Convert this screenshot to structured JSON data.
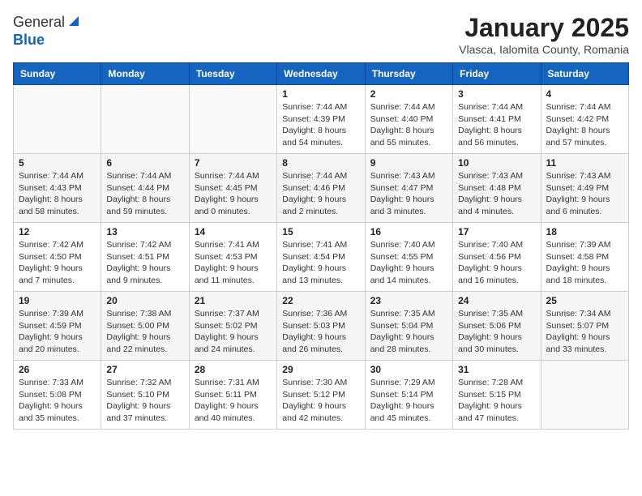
{
  "logo": {
    "general": "General",
    "blue": "Blue"
  },
  "title": "January 2025",
  "location": "Vlasca, Ialomita County, Romania",
  "weekdays": [
    "Sunday",
    "Monday",
    "Tuesday",
    "Wednesday",
    "Thursday",
    "Friday",
    "Saturday"
  ],
  "weeks": [
    [
      {
        "day": "",
        "info": ""
      },
      {
        "day": "",
        "info": ""
      },
      {
        "day": "",
        "info": ""
      },
      {
        "day": "1",
        "sunrise": "Sunrise: 7:44 AM",
        "sunset": "Sunset: 4:39 PM",
        "daylight": "Daylight: 8 hours and 54 minutes."
      },
      {
        "day": "2",
        "sunrise": "Sunrise: 7:44 AM",
        "sunset": "Sunset: 4:40 PM",
        "daylight": "Daylight: 8 hours and 55 minutes."
      },
      {
        "day": "3",
        "sunrise": "Sunrise: 7:44 AM",
        "sunset": "Sunset: 4:41 PM",
        "daylight": "Daylight: 8 hours and 56 minutes."
      },
      {
        "day": "4",
        "sunrise": "Sunrise: 7:44 AM",
        "sunset": "Sunset: 4:42 PM",
        "daylight": "Daylight: 8 hours and 57 minutes."
      }
    ],
    [
      {
        "day": "5",
        "sunrise": "Sunrise: 7:44 AM",
        "sunset": "Sunset: 4:43 PM",
        "daylight": "Daylight: 8 hours and 58 minutes."
      },
      {
        "day": "6",
        "sunrise": "Sunrise: 7:44 AM",
        "sunset": "Sunset: 4:44 PM",
        "daylight": "Daylight: 8 hours and 59 minutes."
      },
      {
        "day": "7",
        "sunrise": "Sunrise: 7:44 AM",
        "sunset": "Sunset: 4:45 PM",
        "daylight": "Daylight: 9 hours and 0 minutes."
      },
      {
        "day": "8",
        "sunrise": "Sunrise: 7:44 AM",
        "sunset": "Sunset: 4:46 PM",
        "daylight": "Daylight: 9 hours and 2 minutes."
      },
      {
        "day": "9",
        "sunrise": "Sunrise: 7:43 AM",
        "sunset": "Sunset: 4:47 PM",
        "daylight": "Daylight: 9 hours and 3 minutes."
      },
      {
        "day": "10",
        "sunrise": "Sunrise: 7:43 AM",
        "sunset": "Sunset: 4:48 PM",
        "daylight": "Daylight: 9 hours and 4 minutes."
      },
      {
        "day": "11",
        "sunrise": "Sunrise: 7:43 AM",
        "sunset": "Sunset: 4:49 PM",
        "daylight": "Daylight: 9 hours and 6 minutes."
      }
    ],
    [
      {
        "day": "12",
        "sunrise": "Sunrise: 7:42 AM",
        "sunset": "Sunset: 4:50 PM",
        "daylight": "Daylight: 9 hours and 7 minutes."
      },
      {
        "day": "13",
        "sunrise": "Sunrise: 7:42 AM",
        "sunset": "Sunset: 4:51 PM",
        "daylight": "Daylight: 9 hours and 9 minutes."
      },
      {
        "day": "14",
        "sunrise": "Sunrise: 7:41 AM",
        "sunset": "Sunset: 4:53 PM",
        "daylight": "Daylight: 9 hours and 11 minutes."
      },
      {
        "day": "15",
        "sunrise": "Sunrise: 7:41 AM",
        "sunset": "Sunset: 4:54 PM",
        "daylight": "Daylight: 9 hours and 13 minutes."
      },
      {
        "day": "16",
        "sunrise": "Sunrise: 7:40 AM",
        "sunset": "Sunset: 4:55 PM",
        "daylight": "Daylight: 9 hours and 14 minutes."
      },
      {
        "day": "17",
        "sunrise": "Sunrise: 7:40 AM",
        "sunset": "Sunset: 4:56 PM",
        "daylight": "Daylight: 9 hours and 16 minutes."
      },
      {
        "day": "18",
        "sunrise": "Sunrise: 7:39 AM",
        "sunset": "Sunset: 4:58 PM",
        "daylight": "Daylight: 9 hours and 18 minutes."
      }
    ],
    [
      {
        "day": "19",
        "sunrise": "Sunrise: 7:39 AM",
        "sunset": "Sunset: 4:59 PM",
        "daylight": "Daylight: 9 hours and 20 minutes."
      },
      {
        "day": "20",
        "sunrise": "Sunrise: 7:38 AM",
        "sunset": "Sunset: 5:00 PM",
        "daylight": "Daylight: 9 hours and 22 minutes."
      },
      {
        "day": "21",
        "sunrise": "Sunrise: 7:37 AM",
        "sunset": "Sunset: 5:02 PM",
        "daylight": "Daylight: 9 hours and 24 minutes."
      },
      {
        "day": "22",
        "sunrise": "Sunrise: 7:36 AM",
        "sunset": "Sunset: 5:03 PM",
        "daylight": "Daylight: 9 hours and 26 minutes."
      },
      {
        "day": "23",
        "sunrise": "Sunrise: 7:35 AM",
        "sunset": "Sunset: 5:04 PM",
        "daylight": "Daylight: 9 hours and 28 minutes."
      },
      {
        "day": "24",
        "sunrise": "Sunrise: 7:35 AM",
        "sunset": "Sunset: 5:06 PM",
        "daylight": "Daylight: 9 hours and 30 minutes."
      },
      {
        "day": "25",
        "sunrise": "Sunrise: 7:34 AM",
        "sunset": "Sunset: 5:07 PM",
        "daylight": "Daylight: 9 hours and 33 minutes."
      }
    ],
    [
      {
        "day": "26",
        "sunrise": "Sunrise: 7:33 AM",
        "sunset": "Sunset: 5:08 PM",
        "daylight": "Daylight: 9 hours and 35 minutes."
      },
      {
        "day": "27",
        "sunrise": "Sunrise: 7:32 AM",
        "sunset": "Sunset: 5:10 PM",
        "daylight": "Daylight: 9 hours and 37 minutes."
      },
      {
        "day": "28",
        "sunrise": "Sunrise: 7:31 AM",
        "sunset": "Sunset: 5:11 PM",
        "daylight": "Daylight: 9 hours and 40 minutes."
      },
      {
        "day": "29",
        "sunrise": "Sunrise: 7:30 AM",
        "sunset": "Sunset: 5:12 PM",
        "daylight": "Daylight: 9 hours and 42 minutes."
      },
      {
        "day": "30",
        "sunrise": "Sunrise: 7:29 AM",
        "sunset": "Sunset: 5:14 PM",
        "daylight": "Daylight: 9 hours and 45 minutes."
      },
      {
        "day": "31",
        "sunrise": "Sunrise: 7:28 AM",
        "sunset": "Sunset: 5:15 PM",
        "daylight": "Daylight: 9 hours and 47 minutes."
      },
      {
        "day": "",
        "info": ""
      }
    ]
  ]
}
